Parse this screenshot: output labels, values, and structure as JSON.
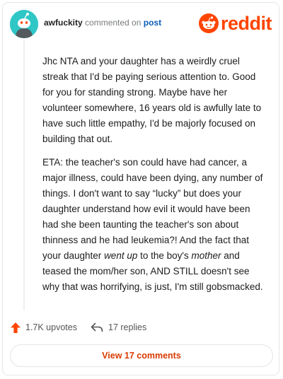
{
  "comment": {
    "username": "awfuckity",
    "commented_text": "commented on",
    "post_link": "post",
    "paragraphs": [
      {
        "parts": [
          {
            "text": "Jhc NTA and your daughter has a weirdly cruel streak that I'd be paying serious attention to. Good for you for standing strong. Maybe have her volunteer somewhere, 16 years old is awfully late to have such little empathy, I'd be majorly focused on building that out.",
            "italic": false
          }
        ]
      },
      {
        "parts": [
          {
            "text": "ETA: the teacher's son could have had cancer, a major illness, could have been dying, any number of things. I don't want to say “lucky” but does your daughter understand how evil it would have been had she been taunting the teacher's son about thinness and he had leukemia?! And the fact that your daughter ",
            "italic": false
          },
          {
            "text": "went up",
            "italic": true
          },
          {
            "text": " to the boy's ",
            "italic": false
          },
          {
            "text": "mother",
            "italic": true
          },
          {
            "text": " and teased the mom/her son, AND STILL doesn't see why that was horrifying, is just, I'm still gobsmacked.",
            "italic": false
          }
        ]
      }
    ]
  },
  "stats": {
    "upvotes": "1.7K upvotes",
    "replies": "17 replies"
  },
  "view_button": "View 17 comments",
  "logo": {
    "text": "reddit"
  },
  "icons": {
    "avatar": "snoo-avatar-icon",
    "logo": "reddit-snoo-icon",
    "upvote": "upvote-arrow-icon",
    "reply": "reply-arrow-icon"
  },
  "colors": {
    "accent": "#ff4500",
    "avatar_bg": "#2fc6c6",
    "link": "#0a5db8",
    "button_text": "#d93a00"
  }
}
